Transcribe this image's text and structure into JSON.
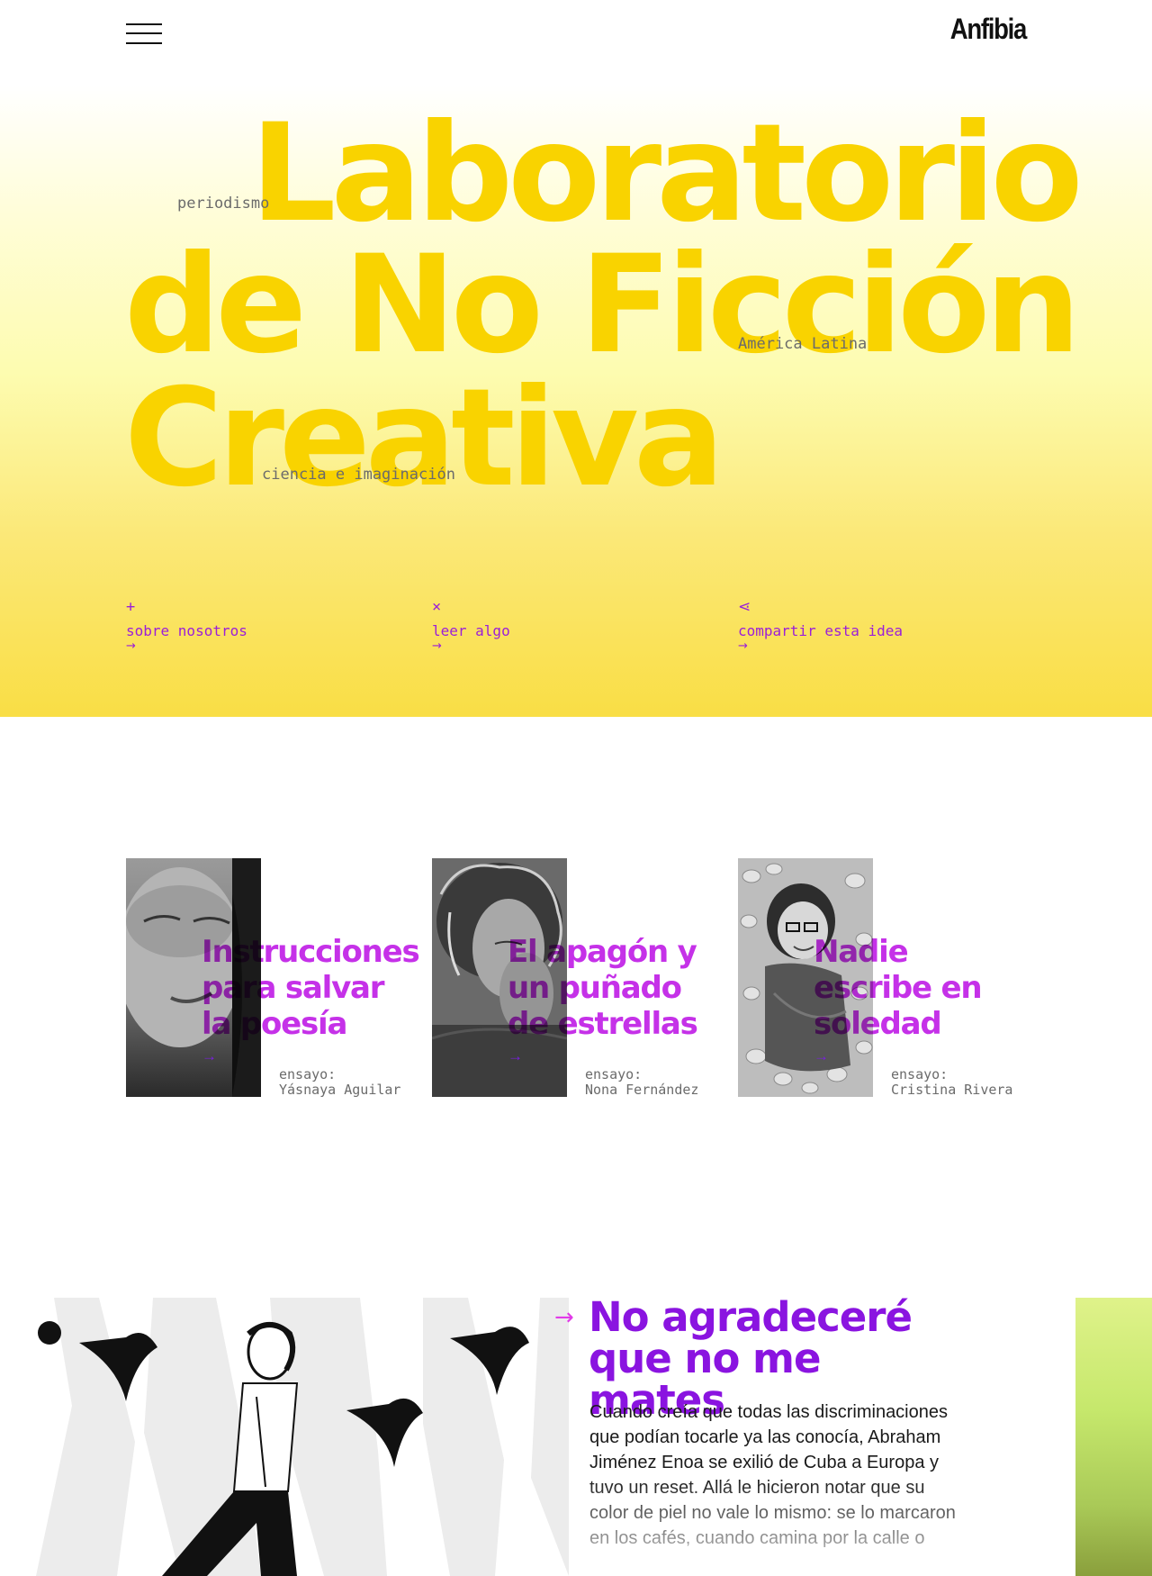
{
  "header": {
    "logo": "Anfibia",
    "menu_icon": "hamburger-icon"
  },
  "hero": {
    "title_lines": [
      "Laboratorio",
      "de No Ficción",
      "Creativa"
    ],
    "tags": [
      "periodismo",
      "América Latina",
      "ciencia e imaginación"
    ],
    "title_color": "#f9d300"
  },
  "actions": [
    {
      "glyph": "+",
      "label": "sobre nosotros",
      "arrow": "→"
    },
    {
      "glyph": "×",
      "label": "leer algo",
      "arrow": "→"
    },
    {
      "glyph": "⋖",
      "label": "compartir esta idea",
      "arrow": "→"
    }
  ],
  "cards": [
    {
      "title": "Instrucciones para salvar la poesía",
      "arrow": "→",
      "meta_type": "ensayo:",
      "meta_author": "Yásnaya Aguilar"
    },
    {
      "title": "El apagón y un puñado de estrellas",
      "arrow": "→",
      "meta_type": "ensayo:",
      "meta_author": "Nona Fernández"
    },
    {
      "title": "Nadie escribe en soledad",
      "arrow": "→",
      "meta_type": "ensayo:",
      "meta_author": "Cristina Rivera"
    }
  ],
  "feature": {
    "arrow": "→",
    "title": "No agradeceré que no me mates",
    "body": "Cuando creía que todas las discriminaciones que podían tocarle ya las conocía, Abraham Jiménez Enoa se exilió de Cuba a Europa y tuvo un reset. Allá le hicieron notar que su color de piel no vale lo mismo: se lo marcaron en los cafés, cuando camina por la calle o ju..."
  },
  "colors": {
    "accent_purple": "#8a14e0",
    "accent_magenta": "#e13be8",
    "hero_yellow": "#f9d300"
  }
}
